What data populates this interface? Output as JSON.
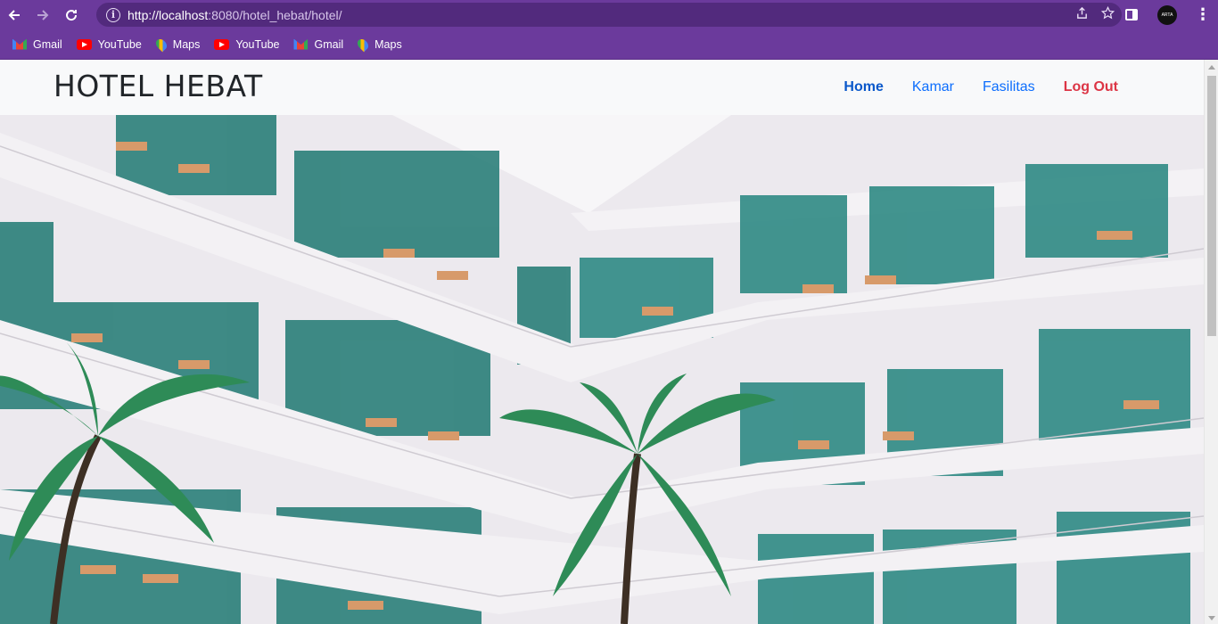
{
  "browser": {
    "url_host": "http://localhost",
    "url_rest": ":8080/hotel_hebat/hotel/",
    "avatar_text": "ARTA",
    "bookmarks": [
      {
        "label": "Gmail",
        "icon": "gmail-icon"
      },
      {
        "label": "YouTube",
        "icon": "youtube-icon"
      },
      {
        "label": "Maps",
        "icon": "maps-icon"
      },
      {
        "label": "YouTube",
        "icon": "youtube-icon"
      },
      {
        "label": "Gmail",
        "icon": "gmail-icon"
      },
      {
        "label": "Maps",
        "icon": "maps-icon"
      }
    ]
  },
  "navbar": {
    "brand": "HOTEL HEBAT",
    "links": [
      {
        "label": "Home",
        "active": true
      },
      {
        "label": "Kamar",
        "active": false
      },
      {
        "label": "Fasilitas",
        "active": false
      },
      {
        "label": "Log Out",
        "active": false
      }
    ]
  },
  "hero": {
    "image": "hotel-courtyard-photo",
    "colors": {
      "wall": "#eae7ec",
      "window": "#2f8a84",
      "palm": "#2e8b57",
      "chair": "#d79a6a"
    }
  }
}
